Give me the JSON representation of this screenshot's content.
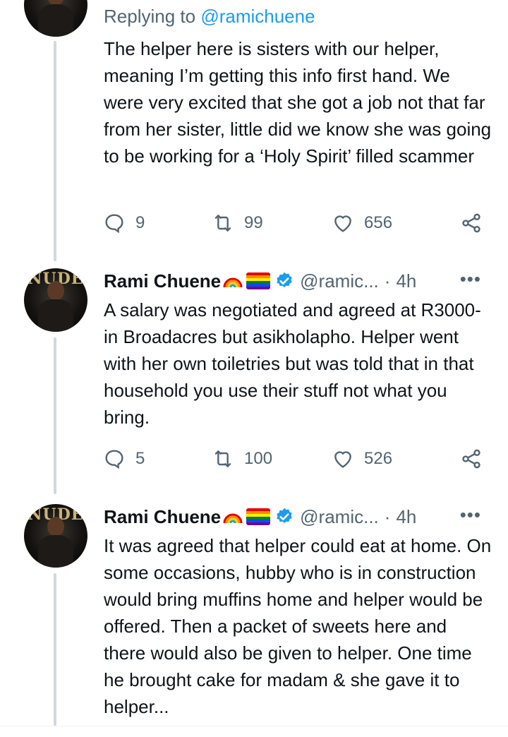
{
  "reply": {
    "replying_prefix": "Replying to ",
    "replying_handle": "@ramichuene",
    "text": "The helper here is sisters with our helper, meaning I’m getting this info first hand. We were very excited that she got a job not that far from her sister, little did we know she was going to be working for a ‘Holy Spirit’ filled scammer",
    "replies": "9",
    "retweets": "99",
    "likes": "656"
  },
  "tweets": [
    {
      "name": "Rami Chuene",
      "handle": "@ramic...",
      "separator": "·",
      "time": "4h",
      "more": "•••",
      "text": "A salary was negotiated and agreed at R3000- in Broadacres but asikholapho. Helper went with her own toiletries but was told that in that household you use their stuff not what you bring.",
      "replies": "5",
      "retweets": "100",
      "likes": "526"
    },
    {
      "name": "Rami Chuene",
      "handle": "@ramic...",
      "separator": "·",
      "time": "4h",
      "more": "•••",
      "text": "It was agreed that helper could eat at home. On some occasions, hubby who is in construction would bring muffins home and helper would be offered. Then a packet of sweets here and there would also be given to helper. One time he brought cake for madam & she gave it to helper..."
    }
  ],
  "avatar_text": "NUDE",
  "colors": {
    "link": "#1d9bf0",
    "secondary": "#536471",
    "thread_line": "#cfd9de",
    "verified": "#1d9bf0"
  },
  "icons": [
    "reply-icon",
    "retweet-icon",
    "like-icon",
    "share-icon",
    "verified-badge-icon",
    "rainbow-emoji",
    "pride-flag-emoji"
  ]
}
